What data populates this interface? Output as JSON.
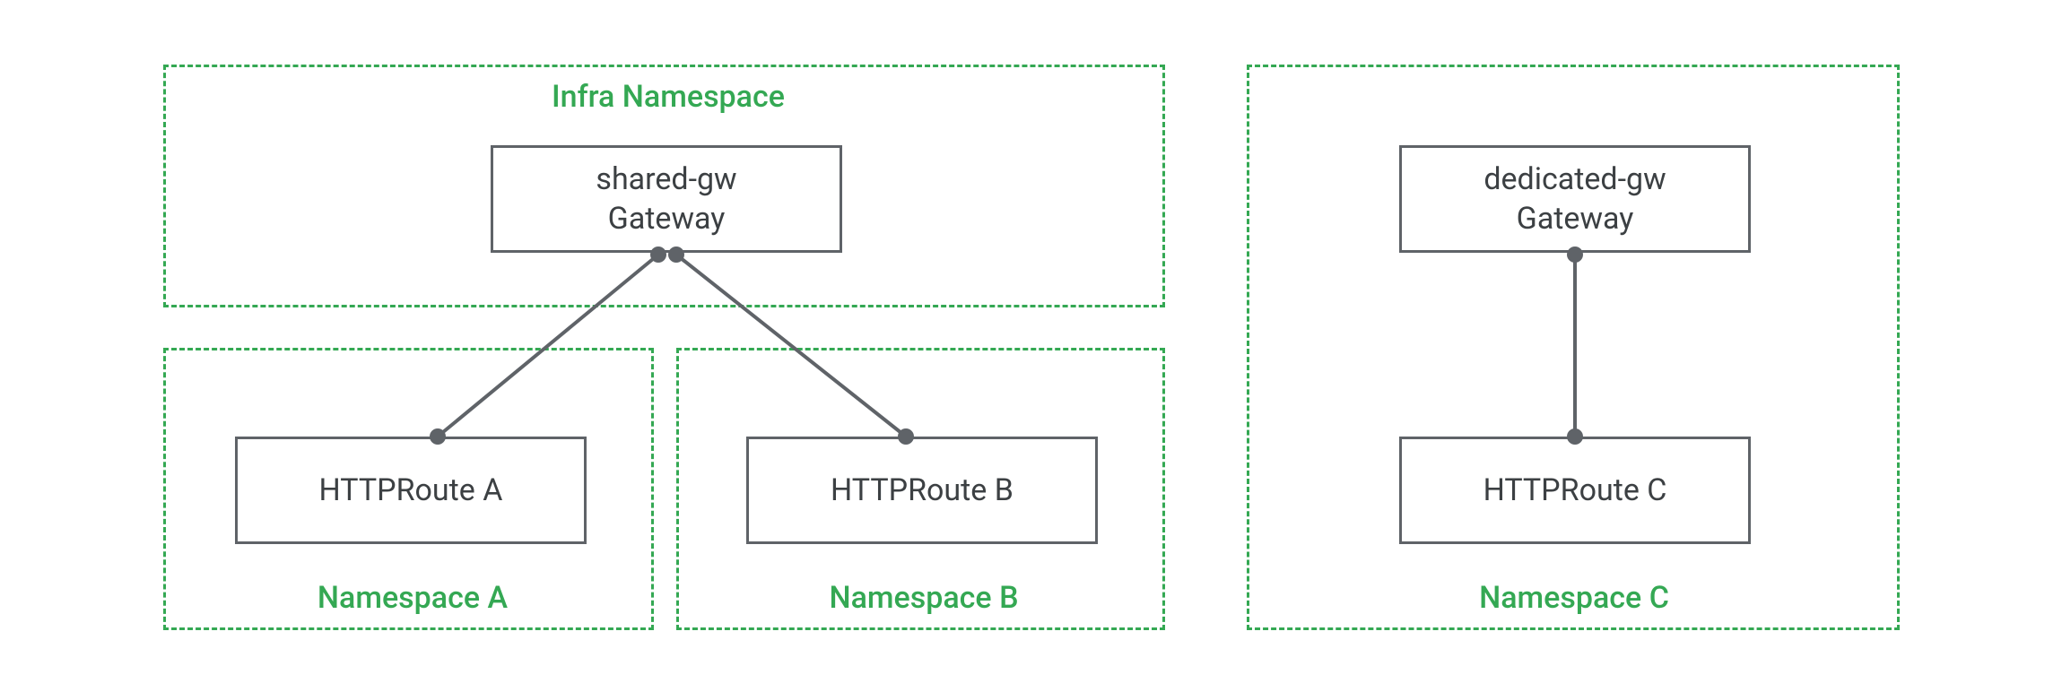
{
  "diagram": {
    "namespaces": {
      "infra": {
        "label": "Infra Namespace"
      },
      "a": {
        "label": "Namespace A"
      },
      "b": {
        "label": "Namespace B"
      },
      "c": {
        "label": "Namespace C"
      }
    },
    "resources": {
      "shared_gw": {
        "line1": "shared-gw",
        "line2": "Gateway"
      },
      "dedicated_gw": {
        "line1": "dedicated-gw",
        "line2": "Gateway"
      },
      "route_a": {
        "label": "HTTPRoute A"
      },
      "route_b": {
        "label": "HTTPRoute B"
      },
      "route_c": {
        "label": "HTTPRoute C"
      }
    },
    "colors": {
      "namespace_border": "#34a853",
      "box_border": "#5f6368",
      "text": "#3c4043"
    }
  }
}
